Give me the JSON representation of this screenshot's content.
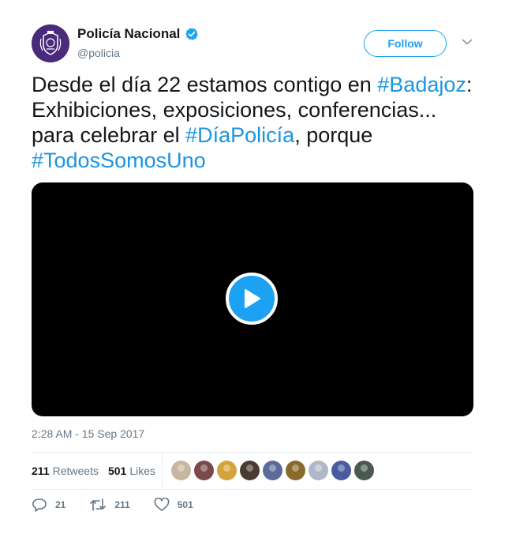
{
  "author": {
    "display_name": "Policía Nacional",
    "handle": "@policia",
    "verified": true,
    "avatar_icon": "police-crest-icon"
  },
  "header": {
    "follow_label": "Follow"
  },
  "tweet": {
    "text_parts": [
      {
        "text": "Desde el día 22 estamos contigo en ",
        "hashtag": false
      },
      {
        "text": "#Badajoz",
        "hashtag": true
      },
      {
        "text": ": Exhibiciones, exposiciones, conferencias... para celebrar el ",
        "hashtag": false
      },
      {
        "text": "#DíaPolicía",
        "hashtag": true
      },
      {
        "text": ", porque ",
        "hashtag": false
      },
      {
        "text": "#TodosSomosUno",
        "hashtag": true
      }
    ],
    "timestamp": "2:28 AM - 15 Sep 2017"
  },
  "stats": {
    "retweets_count": "211",
    "retweets_label": "Retweets",
    "likes_count": "501",
    "likes_label": "Likes",
    "liker_avatar_colors": [
      "#c9b6a0",
      "#7a4a4a",
      "#d6a23a",
      "#4a3a30",
      "#5a6a9a",
      "#8a6a2a",
      "#b0b8c8",
      "#4a5aa0",
      "#4a5a50"
    ]
  },
  "actions": {
    "reply_count": "21",
    "retweet_count": "211",
    "like_count": "501"
  },
  "colors": {
    "accent": "#1da1f2",
    "hashtag": "#1b95e0",
    "muted": "#657786",
    "brand_avatar": "#4a2a7a"
  }
}
